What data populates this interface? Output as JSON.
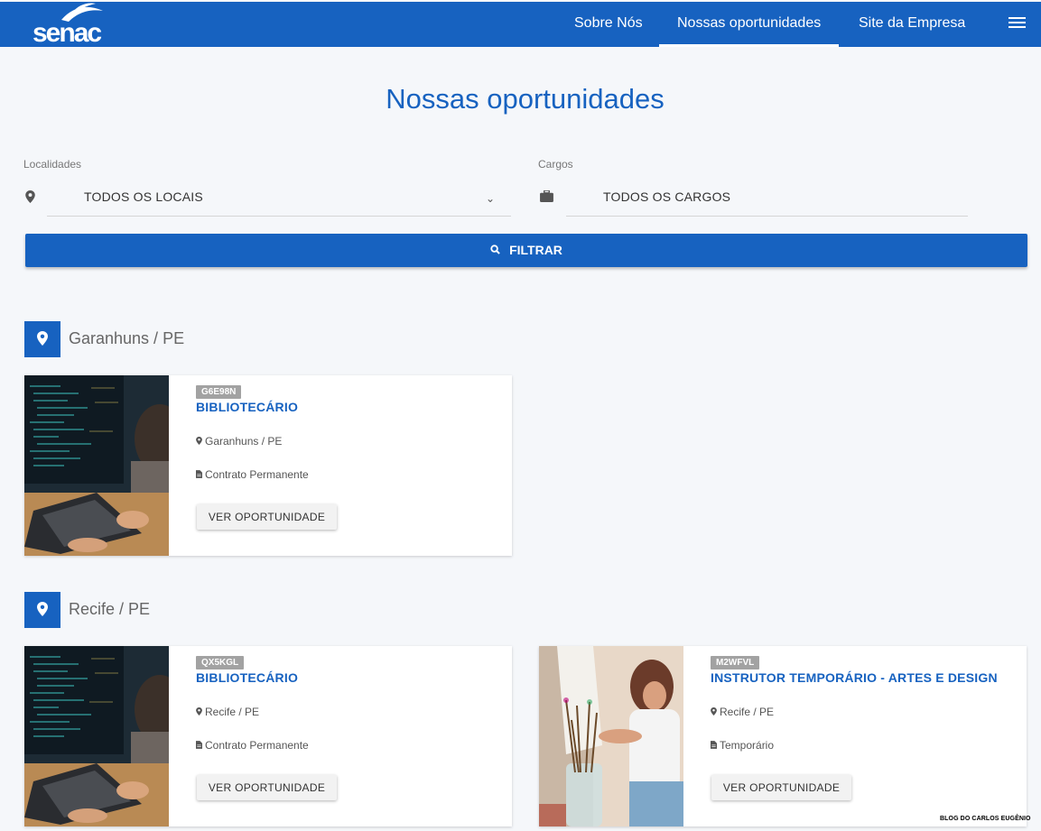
{
  "header": {
    "logo_text": "senac",
    "nav": [
      "Sobre Nós",
      "Nossas oportunidades",
      "Site da Empresa"
    ]
  },
  "page_title": "Nossas oportunidades",
  "filters": {
    "localidades_label": "Localidades",
    "localidades_value": "TODOS OS LOCAIS",
    "cargos_label": "Cargos",
    "cargos_value": "TODOS OS CARGOS",
    "filter_button": "FILTRAR"
  },
  "groups": [
    {
      "location": "Garanhuns / PE",
      "jobs": [
        {
          "code": "G6E98N",
          "title": "BIBLIOTECÁRIO",
          "location": "Garanhuns / PE",
          "contract": "Contrato Permanente",
          "button": "VER OPORTUNIDADE"
        }
      ]
    },
    {
      "location": "Recife / PE",
      "jobs": [
        {
          "code": "QX5KGL",
          "title": "BIBLIOTECÁRIO",
          "location": "Recife / PE",
          "contract": "Contrato Permanente",
          "button": "VER OPORTUNIDADE"
        },
        {
          "code": "M2WFVL",
          "title": "INSTRUTOR TEMPORÁRIO - ARTES E DESIGN",
          "location": "Recife / PE",
          "contract": "Temporário",
          "button": "VER OPORTUNIDADE"
        }
      ]
    }
  ],
  "watermark": "BLOG DO CARLOS EUGÊNIO",
  "colors": {
    "brand": "#1762c0",
    "tag": "#a2a2a2",
    "background": "#f5f7fa"
  },
  "icons": [
    "bird-logo-icon",
    "menu-icon",
    "map-pin-icon",
    "briefcase-icon",
    "search-icon",
    "document-icon"
  ]
}
